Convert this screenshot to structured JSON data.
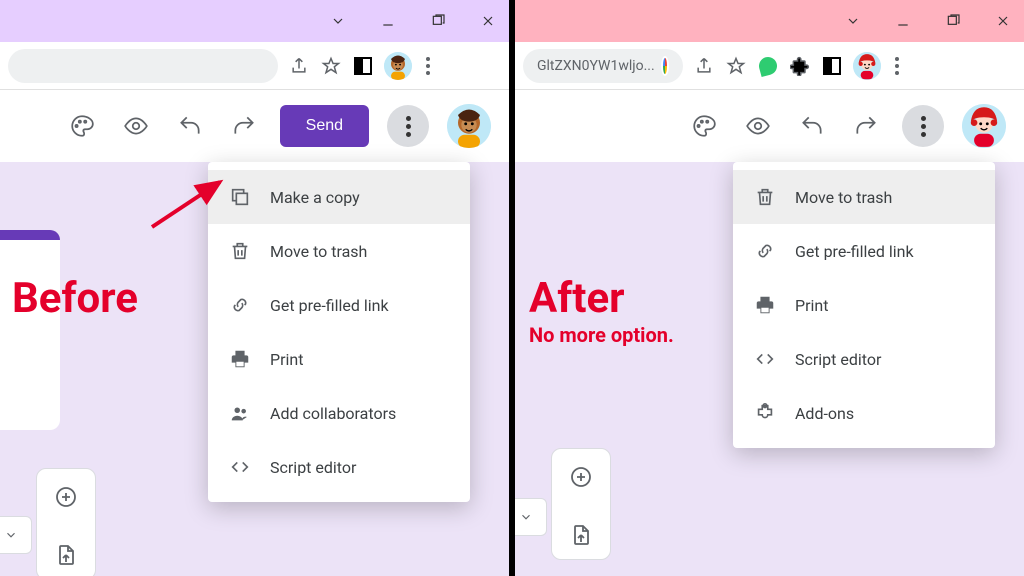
{
  "before": {
    "label": "Before",
    "toolbar": {
      "send": "Send"
    },
    "menu": [
      {
        "icon": "copy-icon",
        "label": "Make a copy",
        "hover": true
      },
      {
        "icon": "trash-icon",
        "label": "Move to trash",
        "hover": false
      },
      {
        "icon": "link-icon",
        "label": "Get pre-filled link",
        "hover": false
      },
      {
        "icon": "print-icon",
        "label": "Print",
        "hover": false
      },
      {
        "icon": "people-icon",
        "label": "Add collaborators",
        "hover": false
      },
      {
        "icon": "code-icon",
        "label": "Script editor",
        "hover": false
      }
    ]
  },
  "after": {
    "label": "After",
    "sublabel": "No more option.",
    "url_fragment": "GltZXN0YW1wljo...",
    "menu": [
      {
        "icon": "trash-icon",
        "label": "Move to trash",
        "hover": true
      },
      {
        "icon": "link-icon",
        "label": "Get pre-filled link",
        "hover": false
      },
      {
        "icon": "print-icon",
        "label": "Print",
        "hover": false
      },
      {
        "icon": "code-icon",
        "label": "Script editor",
        "hover": false
      },
      {
        "icon": "addon-icon",
        "label": "Add-ons",
        "hover": false
      }
    ]
  }
}
